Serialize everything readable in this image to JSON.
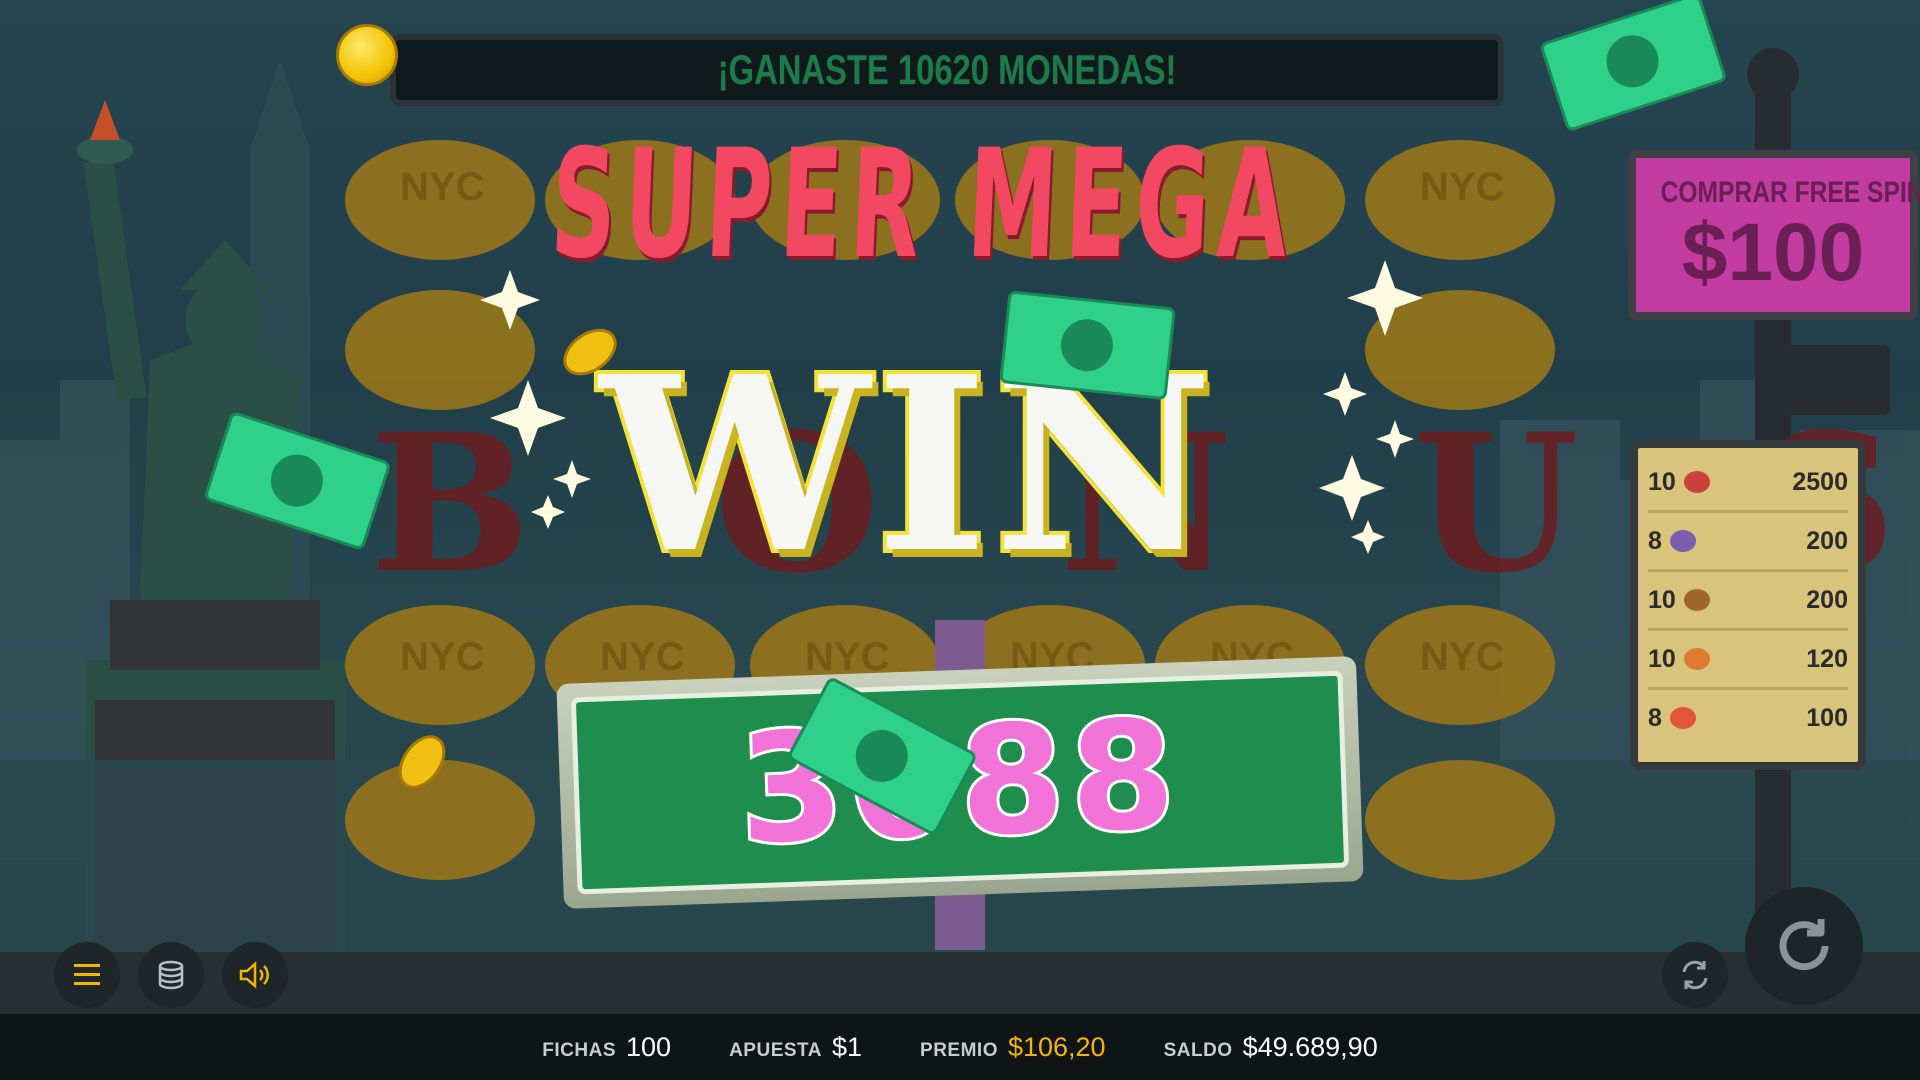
{
  "banner": {
    "message": "¡GANASTE 10620 MONEDAS!"
  },
  "buy_free_spins": {
    "title": "COMPRAR FREE SPINS",
    "price": "$100"
  },
  "paytable": {
    "rows": [
      {
        "count": "10",
        "symbol": "red-monster-icon",
        "payout": "2500"
      },
      {
        "count": "8",
        "symbol": "purple-monster-icon",
        "payout": "200"
      },
      {
        "count": "10",
        "symbol": "pretzel-icon",
        "payout": "200"
      },
      {
        "count": "10",
        "symbol": "orange-monster-icon",
        "payout": "120"
      },
      {
        "count": "8",
        "symbol": "pizza-icon",
        "payout": "100"
      }
    ]
  },
  "overlay": {
    "line1": "SUPER MEGA",
    "line2": "WIN",
    "amount": "3088"
  },
  "background": {
    "reel_symbol": "NYC",
    "bonus_text": "BONUS!"
  },
  "controls": {
    "menu": "menu-icon",
    "chips": "coins-stack-icon",
    "sound": "speaker-icon",
    "autoplay": "autoplay-icon",
    "spin": "spin-icon"
  },
  "status": {
    "chips_label": "FICHAS",
    "chips_value": "100",
    "bet_label": "APUESTA",
    "bet_value": "$1",
    "prize_label": "PREMIO",
    "prize_value": "$106,20",
    "balance_label": "SALDO",
    "balance_value": "$49.689,90"
  },
  "colors": {
    "prize": "#f5b400",
    "super_mega": "#f24862",
    "amount": "#f273d8",
    "sign_green": "#1f8d4e"
  }
}
